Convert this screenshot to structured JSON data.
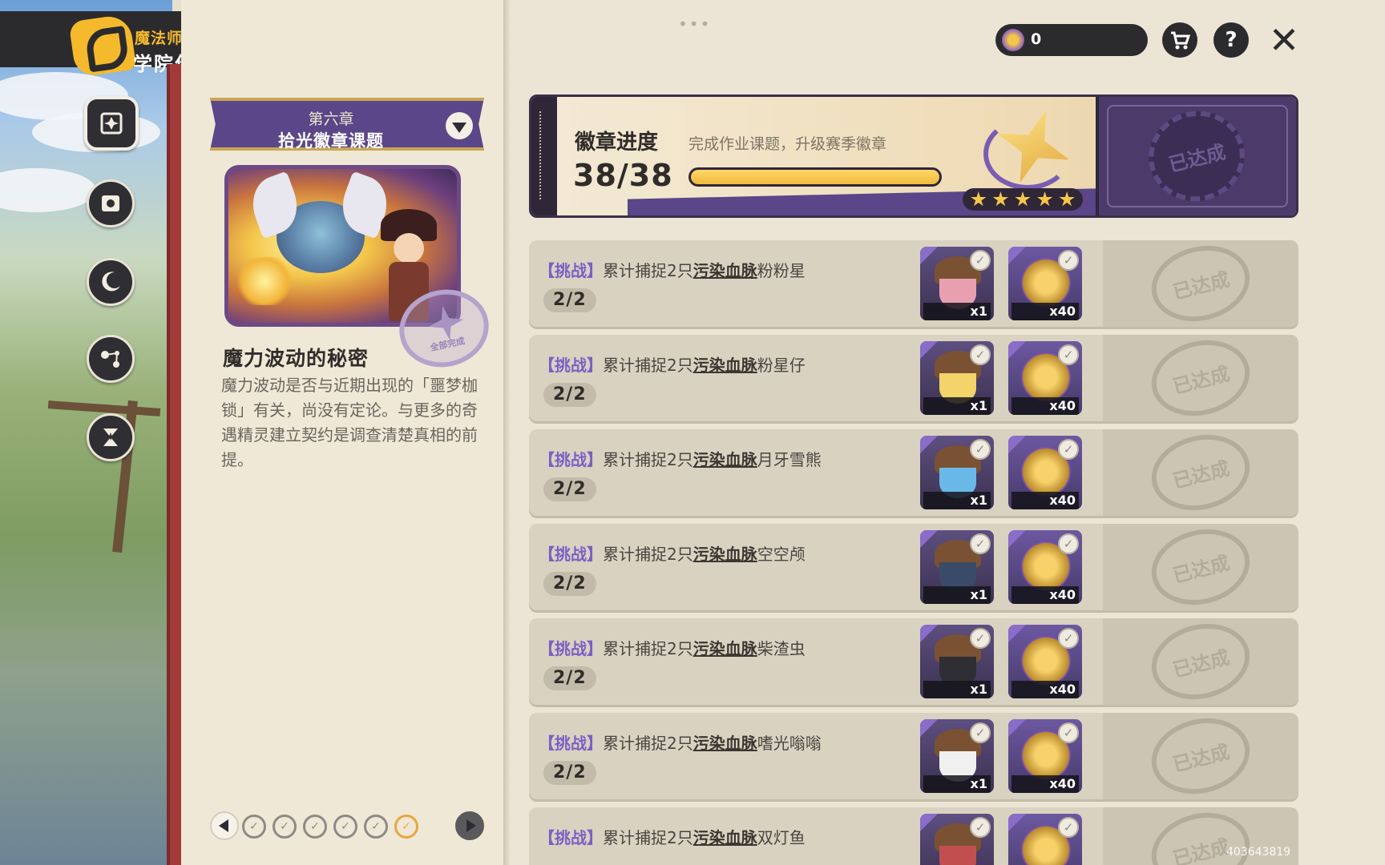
{
  "app": {
    "logo_sub": "魔法师手册",
    "logo_title": "学院作业"
  },
  "nav": {
    "items": [
      {
        "name": "homework",
        "icon": "badge-book-icon",
        "active": true
      },
      {
        "name": "book",
        "icon": "spellbook-icon"
      },
      {
        "name": "star-moon",
        "icon": "star-moon-icon"
      },
      {
        "name": "constellation",
        "icon": "constellation-icon"
      },
      {
        "name": "star-hourglass",
        "icon": "star-hourglass-icon"
      }
    ]
  },
  "chapter": {
    "number": "第六章",
    "title": "拾光徽章课题"
  },
  "story": {
    "stamp_label": "全部完成",
    "title": "魔力波动的秘密",
    "description": "魔力波动是否与近期出现的「噩梦枷锁」有关，尚没有定论。与更多的奇遇精灵建立契约是调查清楚真相的前提。"
  },
  "pager": {
    "total_pages": 6,
    "current_page": 6
  },
  "topbar": {
    "coin_value": "0",
    "help_label": "?"
  },
  "badge": {
    "label": "徽章进度",
    "description": "完成作业课题，升级赛季徽章",
    "progress_text": "38/38",
    "progress_fraction": 1.0,
    "stars": 5,
    "reward_stamp": "已达成"
  },
  "tasks": {
    "tag": "【挑战】",
    "prefix": "累计捕捉2只",
    "keyword": "污染血脉",
    "done_stamp": "已达成",
    "items": [
      {
        "target": "粉粉星",
        "progress": "2/2",
        "reward1_qty": "x1",
        "reward2_qty": "x40",
        "acorn_color": "#e8a0b0"
      },
      {
        "target": "粉星仔",
        "progress": "2/2",
        "reward1_qty": "x1",
        "reward2_qty": "x40",
        "acorn_color": "#f3d36a"
      },
      {
        "target": "月牙雪熊",
        "progress": "2/2",
        "reward1_qty": "x1",
        "reward2_qty": "x40",
        "acorn_color": "#6ab8e8"
      },
      {
        "target": "空空颅",
        "progress": "2/2",
        "reward1_qty": "x1",
        "reward2_qty": "x40",
        "acorn_color": "#3a4b6a"
      },
      {
        "target": "柴渣虫",
        "progress": "2/2",
        "reward1_qty": "x1",
        "reward2_qty": "x40",
        "acorn_color": "#2e2e34"
      },
      {
        "target": "嗜光嗡嗡",
        "progress": "2/2",
        "reward1_qty": "x1",
        "reward2_qty": "x40",
        "acorn_color": "#f0f0f0"
      },
      {
        "target": "双灯鱼",
        "progress": "",
        "reward1_qty": "",
        "reward2_qty": "",
        "acorn_color": "#c24f4f"
      }
    ]
  },
  "watermark": "403643819"
}
